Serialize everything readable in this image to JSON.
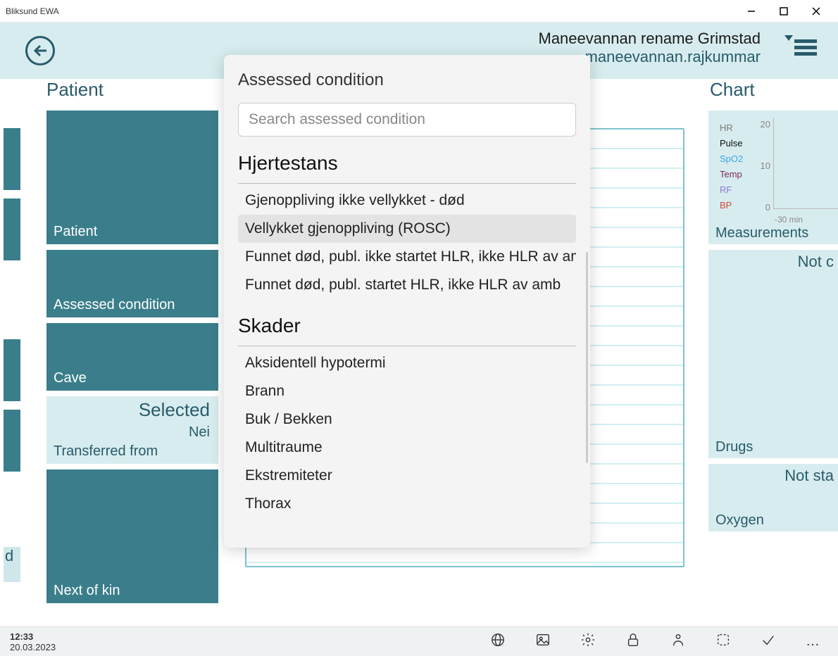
{
  "window": {
    "title": "Bliksund EWA"
  },
  "header": {
    "user_line1": "Maneevannan rename Grimstad",
    "user_line2": "maneevannan.rajkummar"
  },
  "left_gutter_sel": "d",
  "patient": {
    "section": "Patient",
    "cards": {
      "patient": "Patient",
      "assessed": "Assessed condition",
      "cave": "Cave",
      "transferred": "Transferred from",
      "transferred_selected": "Selected",
      "transferred_value": "Nei",
      "nextkin": "Next of kin"
    }
  },
  "chart": {
    "section": "Chart",
    "legend": [
      {
        "label": "HR",
        "color": "#7a7a7a"
      },
      {
        "label": "Pulse",
        "color": "#111"
      },
      {
        "label": "SpO2",
        "color": "#3fa5e8"
      },
      {
        "label": "Temp",
        "color": "#7d2a5b"
      },
      {
        "label": "RF",
        "color": "#8a7ad6"
      },
      {
        "label": "BP",
        "color": "#d04a3a"
      }
    ],
    "yticks": [
      "20",
      "10",
      "0"
    ],
    "xlabel": "-30 min",
    "measurements": "Measurements",
    "drugs": "Drugs",
    "drugs_status": "Not c",
    "oxygen": "Oxygen",
    "oxygen_status": "Not sta"
  },
  "popup": {
    "title": "Assessed condition",
    "search_placeholder": "Search assessed condition",
    "groups": [
      {
        "header": "Hjertestans",
        "items": [
          "Gjenoppliving ikke vellykket - død",
          "Vellykket gjenoppliving (ROSC)",
          "Funnet død, publ. ikke startet HLR, ikke HLR av amb",
          "Funnet død, publ. startet HLR, ikke HLR av amb"
        ],
        "hover_index": 1
      },
      {
        "header": "Skader",
        "items": [
          "Aksidentell hypotermi",
          "Brann",
          "Buk / Bekken",
          "Multitraume",
          "Ekstremiteter",
          "Thorax"
        ]
      }
    ]
  },
  "bottombar": {
    "time": "12:33",
    "date": "20.03.2023"
  }
}
